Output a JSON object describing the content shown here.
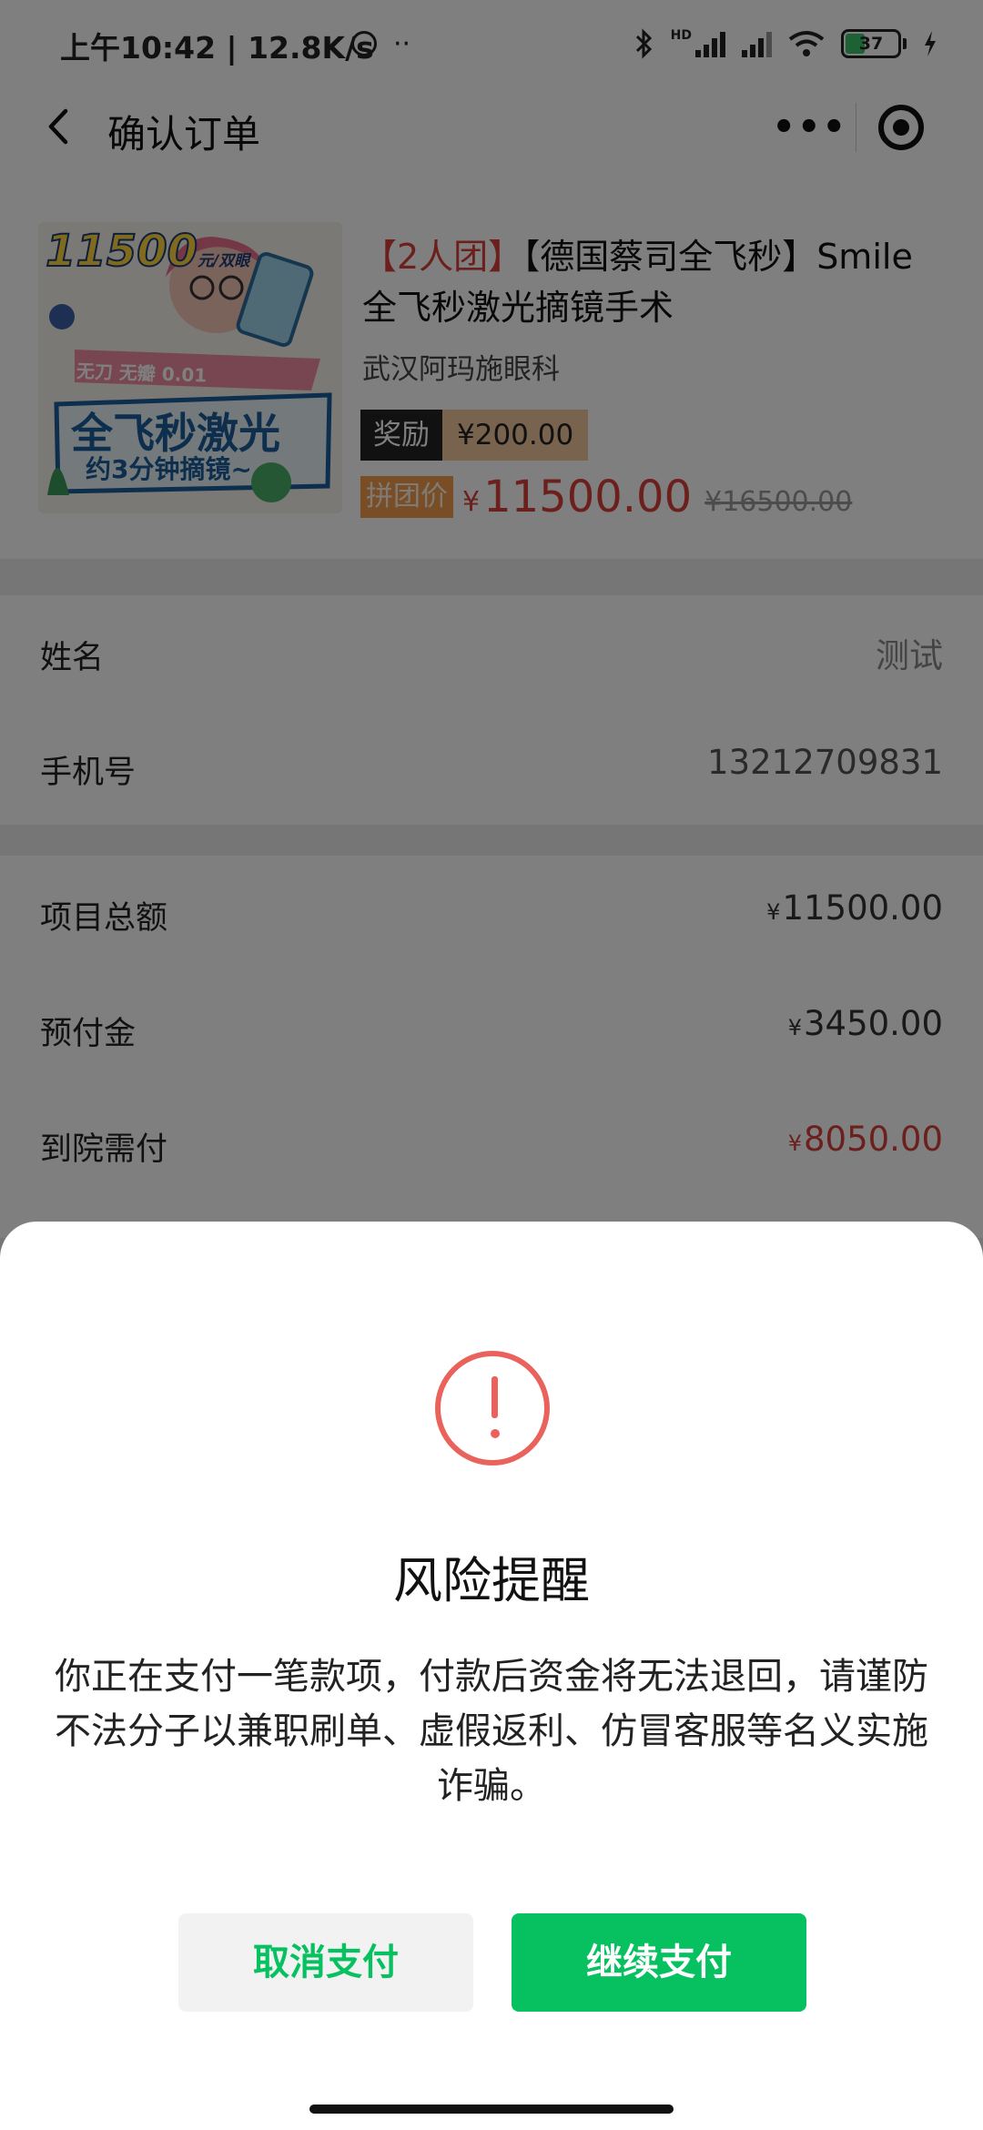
{
  "status_bar": {
    "time": "上午10:42 | 12.8K/s",
    "alarm_icon": "alarm-icon",
    "more_dots": "··",
    "bluetooth_icon": "bluetooth-icon",
    "hd_label": "HD",
    "battery_level": "37",
    "charging_icon": "charging-icon"
  },
  "nav": {
    "title": "确认订单",
    "more_label": "•••",
    "back_icon": "chevron-left-icon",
    "close_icon": "target-icon"
  },
  "product": {
    "image_headline": "11500",
    "image_headline_unit": "元/双眼",
    "image_tags": "无刀 无瓣 0.01",
    "image_main": "全飞秒激光",
    "image_sub": "约3分钟摘镜~",
    "tag": "【2人团】",
    "name": "【德国蔡司全飞秒】Smile全飞秒激光摘镜手术",
    "hospital": "武汉阿玛施眼科",
    "reward_label": "奖励",
    "reward_value": "¥200.00",
    "group_price_label": "拼团价",
    "price_symbol": "¥",
    "price": "11500.00",
    "original_price": "¥16500.00"
  },
  "buyer": {
    "name_label": "姓名",
    "name_value": "测试",
    "phone_label": "手机号",
    "phone_value": "13212709831"
  },
  "payment": {
    "yen": "¥",
    "total_label": "项目总额",
    "total_value": "11500.00",
    "deposit_label": "预付金",
    "deposit_value": "3450.00",
    "due_label": "到院需付",
    "due_value": "8050.00"
  },
  "dialog": {
    "icon": "exclamation-circle-icon",
    "title": "风险提醒",
    "message": "你正在支付一笔款项，付款后资金将无法退回，请谨防不法分子以兼职刷单、虚假返利、仿冒客服等名义实施诈骗。",
    "cancel_label": "取消支付",
    "continue_label": "继续支付"
  },
  "colors": {
    "accent_green": "#07c160",
    "price_red": "#d8413a",
    "warning_red": "#e9635c"
  }
}
